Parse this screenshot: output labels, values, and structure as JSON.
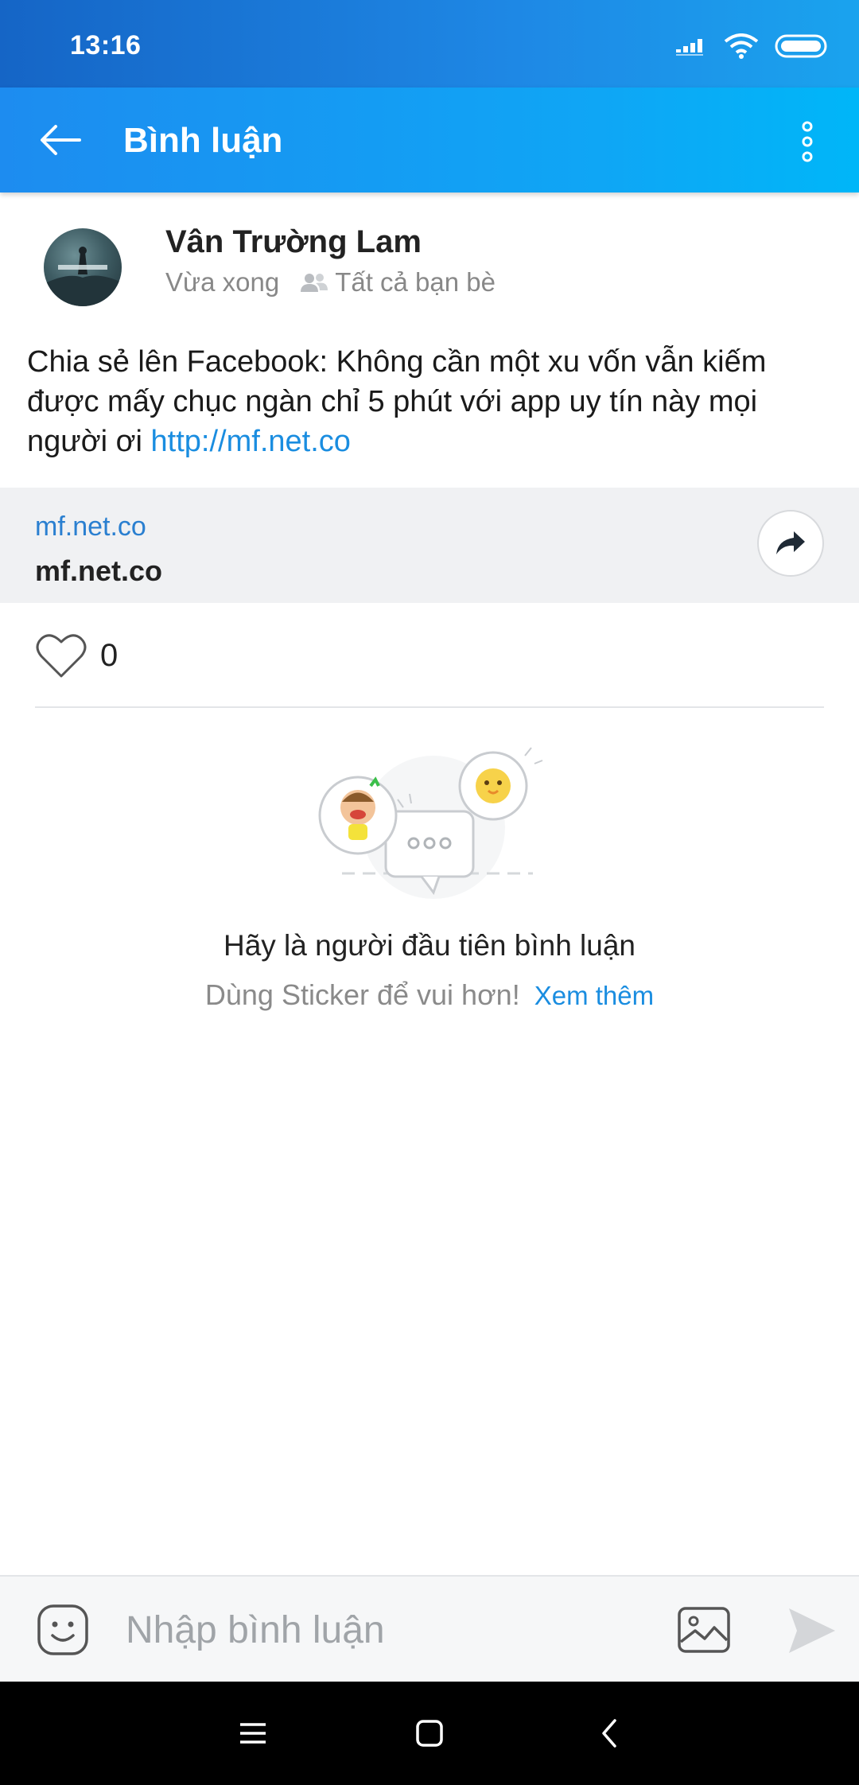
{
  "status_bar": {
    "time": "13:16"
  },
  "app_bar": {
    "title": "Bình luận"
  },
  "post": {
    "author": "Vân Trường Lam",
    "time": "Vừa xong",
    "privacy": "Tất cả bạn bè",
    "text": "Chia sẻ lên Facebook: Không cần một xu vốn vẫn kiếm được mấy chục ngàn chỉ 5 phút với app uy tín này mọi người ơi ",
    "link": "http://mf.net.co"
  },
  "link_preview": {
    "domain": "mf.net.co",
    "title": "mf.net.co"
  },
  "reactions": {
    "like_count": "0"
  },
  "empty_state": {
    "title": "Hãy là người đầu tiên bình luận",
    "subtitle": "Dùng Sticker để vui hơn!",
    "see_more": "Xem thêm"
  },
  "input": {
    "placeholder": "Nhập bình luận"
  },
  "icons": {
    "back": "arrow-left-icon",
    "menu": "more-vertical-icon",
    "privacy": "friends-icon",
    "share": "share-arrow-icon",
    "like": "heart-outline-icon",
    "emoji": "smiley-icon",
    "image": "image-icon",
    "send": "send-icon"
  },
  "colors": {
    "accent": "#1a8de0",
    "header_start": "#1d8cf0",
    "header_end": "#00b6f8"
  }
}
